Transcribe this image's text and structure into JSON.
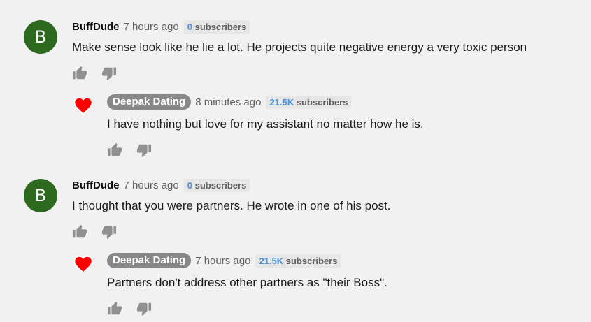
{
  "comments": [
    {
      "avatar_letter": "B",
      "author": "BuffDude",
      "time": "7 hours ago",
      "subs_count": "0",
      "subs_label": "subscribers",
      "text": "Make sense look like he lie a lot. He projects quite negative energy a very toxic person",
      "reply": {
        "icon": "heart-icon",
        "author": "Deepak Dating",
        "time": "8 minutes ago",
        "subs_count": "21.5K",
        "subs_label": "subscribers",
        "text": "I have nothing but love for my assistant no matter how he is."
      }
    },
    {
      "avatar_letter": "B",
      "author": "BuffDude",
      "time": "7 hours ago",
      "subs_count": "0",
      "subs_label": "subscribers",
      "text": "I thought that you were partners. He wrote in one of his post.",
      "reply": {
        "icon": "heart-icon",
        "author": "Deepak Dating",
        "time": "7 hours ago",
        "subs_count": "21.5K",
        "subs_label": "subscribers",
        "text": "Partners don't address other partners as \"their Boss\"."
      }
    }
  ],
  "colors": {
    "avatar_bg": "#2d6a1f",
    "author_pill_bg": "#888888",
    "subs_count": "#4b90d9",
    "heart": "#ff0000",
    "background": "#f1f1f1"
  }
}
